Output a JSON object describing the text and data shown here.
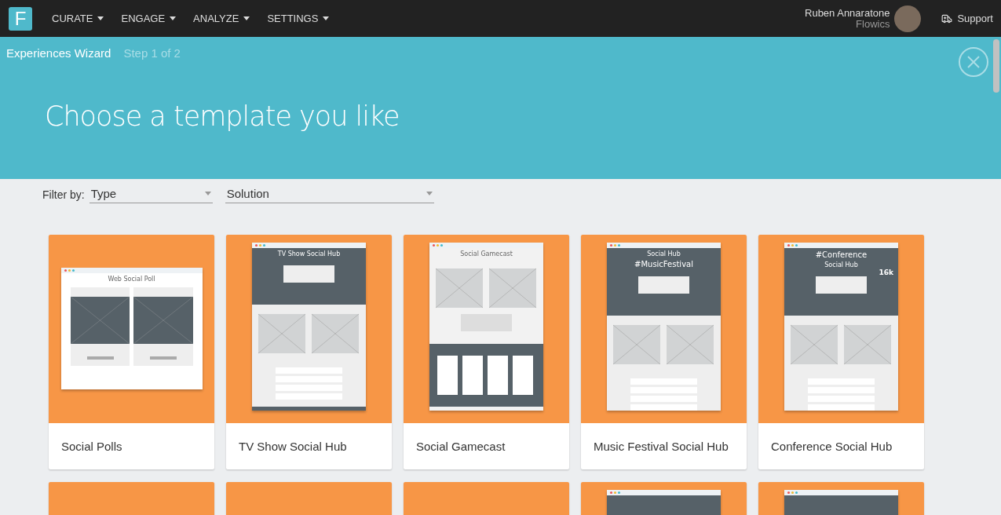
{
  "nav": {
    "logo": "F",
    "menus": [
      {
        "label": "CURATE"
      },
      {
        "label": "ENGAGE"
      },
      {
        "label": "ANALYZE"
      },
      {
        "label": "SETTINGS"
      }
    ],
    "user": {
      "name": "Ruben Annaratone",
      "org": "Flowics"
    },
    "support": "Support"
  },
  "wizard": {
    "title": "Experiences Wizard",
    "step": "Step 1 of 2",
    "heading": "Choose a template you like"
  },
  "filters": {
    "label": "Filter by:",
    "selects": [
      {
        "value": "Type"
      },
      {
        "value": "Solution"
      }
    ]
  },
  "templates": [
    {
      "kind": "template",
      "caption": "Social Polls",
      "preview": {
        "wide": true,
        "dark": false,
        "titles": [
          "Web Social Poll"
        ]
      }
    },
    {
      "kind": "template",
      "caption": "TV Show Social Hub",
      "preview": {
        "wide": false,
        "dark": true,
        "titles": [
          "TV Show Social Hub"
        ]
      }
    },
    {
      "kind": "template",
      "caption": "Social Gamecast",
      "preview": {
        "wide": false,
        "dark": false,
        "titles": [
          "Social Gamecast"
        ]
      }
    },
    {
      "kind": "template",
      "caption": "Music Festival Social Hub",
      "preview": {
        "wide": false,
        "dark": true,
        "titles": [
          "Social Hub",
          "#MusicFestival"
        ]
      }
    },
    {
      "kind": "template",
      "caption": "Conference Social Hub",
      "preview": {
        "wide": false,
        "dark": true,
        "titles": [
          "#Conference",
          "Social Hub"
        ],
        "badge": "16k"
      }
    },
    {
      "kind": "template"
    },
    {
      "kind": "template"
    },
    {
      "kind": "template"
    },
    {
      "kind": "template",
      "preview": {
        "wide": false,
        "dark": true
      }
    },
    {
      "kind": "template",
      "preview": {
        "wide": false,
        "dark": true
      }
    }
  ]
}
